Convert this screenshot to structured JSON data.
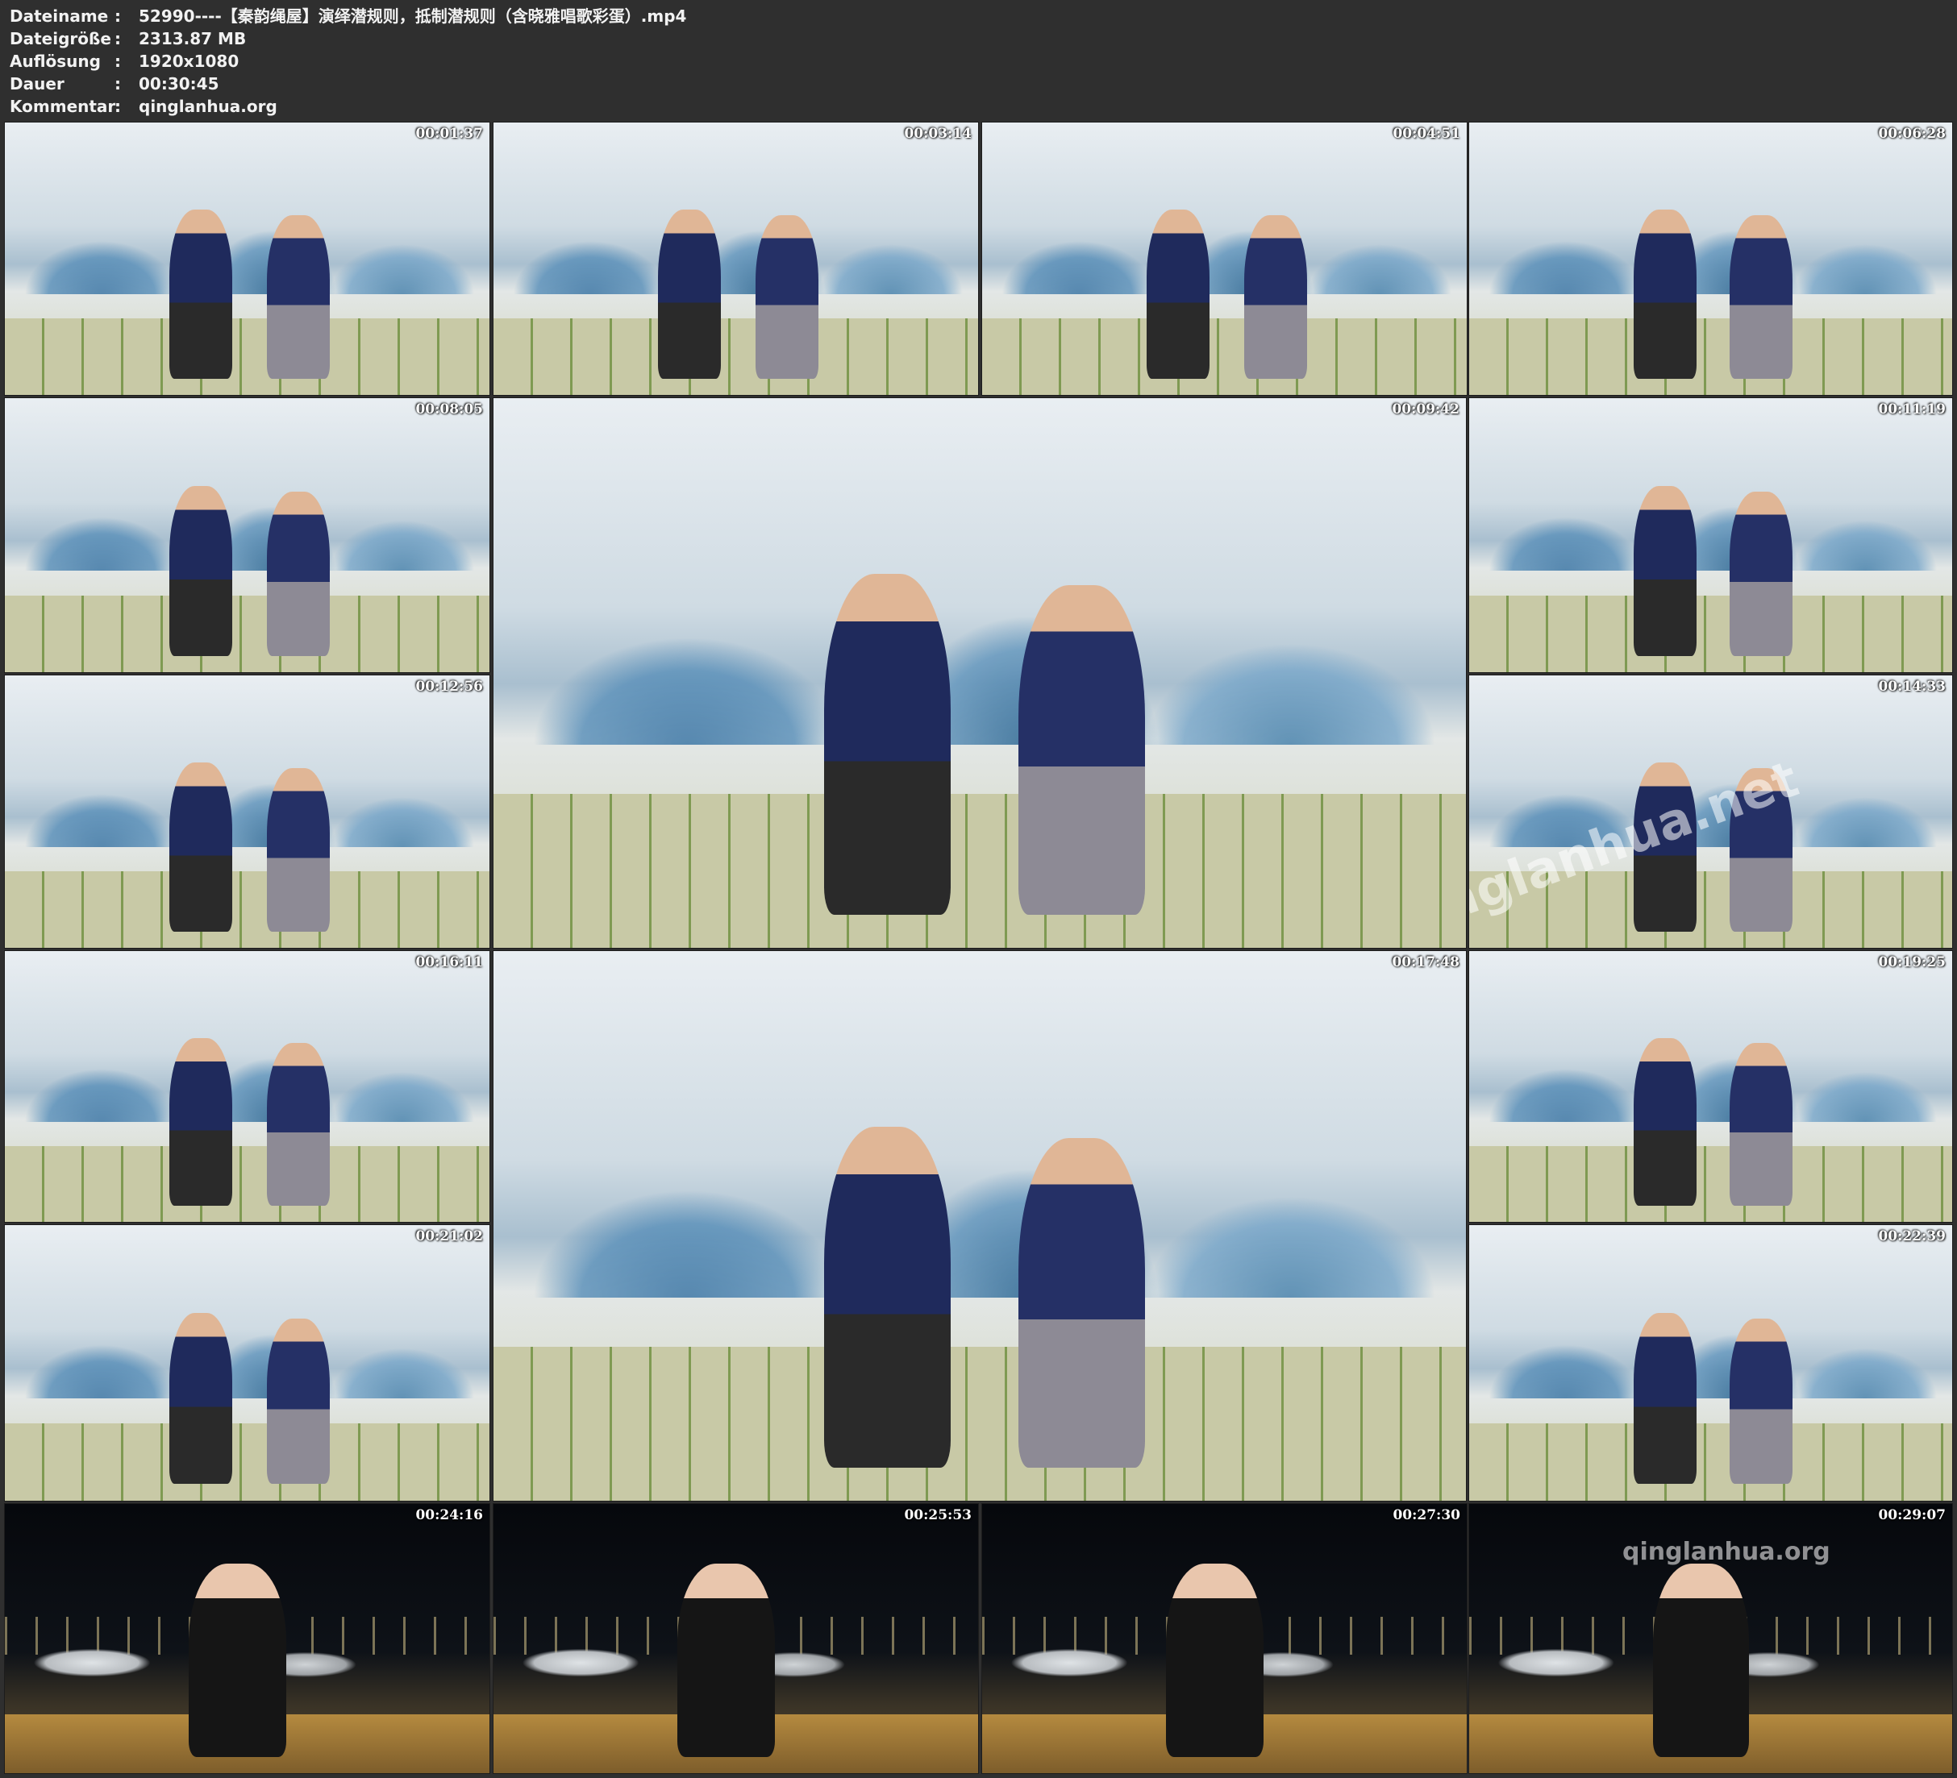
{
  "info": [
    {
      "key": "Dateiname",
      "sep": ":",
      "value": "52990----【秦韵绳屋】演绎潜规则，抵制潜规则（含晓雅唱歌彩蛋）.mp4"
    },
    {
      "key": "Dateigröße",
      "sep": ":",
      "value": "2313.87 MB"
    },
    {
      "key": "Auflösung",
      "sep": ":",
      "value": "1920x1080"
    },
    {
      "key": "Dauer",
      "sep": ":",
      "value": "00:30:45"
    },
    {
      "key": "Kommentar",
      "sep": ":",
      "value": "qinglanhua.org"
    }
  ],
  "thumbnails": [
    {
      "timestamp": "00:01:37",
      "scene": "day"
    },
    {
      "timestamp": "00:03:14",
      "scene": "day"
    },
    {
      "timestamp": "00:04:51",
      "scene": "day"
    },
    {
      "timestamp": "00:06:28",
      "scene": "day"
    },
    {
      "timestamp": "00:08:05",
      "scene": "day"
    },
    {
      "timestamp": "00:09:42",
      "scene": "day"
    },
    {
      "timestamp": "00:11:19",
      "scene": "day"
    },
    {
      "timestamp": "00:12:56",
      "scene": "day"
    },
    {
      "timestamp": "00:14:33",
      "scene": "day"
    },
    {
      "timestamp": "00:16:11",
      "scene": "day"
    },
    {
      "timestamp": "00:17:48",
      "scene": "day"
    },
    {
      "timestamp": "00:19:25",
      "scene": "day"
    },
    {
      "timestamp": "00:21:02",
      "scene": "day"
    },
    {
      "timestamp": "00:22:39",
      "scene": "day"
    },
    {
      "timestamp": "00:24:16",
      "scene": "night"
    },
    {
      "timestamp": "00:25:53",
      "scene": "night"
    },
    {
      "timestamp": "00:27:30",
      "scene": "night"
    },
    {
      "timestamp": "00:29:07",
      "scene": "night"
    }
  ],
  "watermarks": [
    "qinglanhua.net",
    "qinglanhua.org"
  ]
}
